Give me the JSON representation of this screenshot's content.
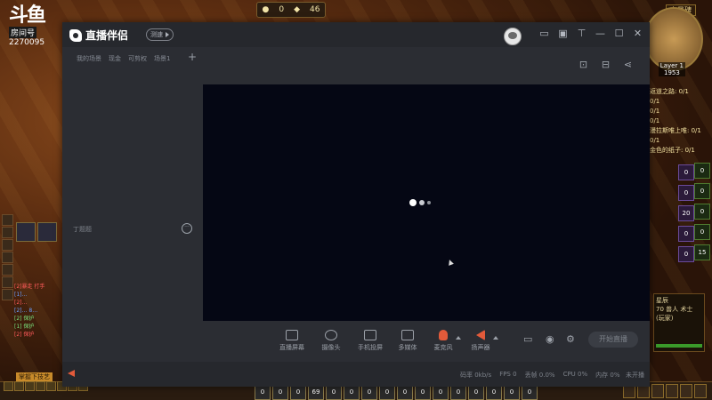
{
  "game": {
    "topbar": {
      "coins": "0",
      "gems": "46"
    },
    "douyu": {
      "logo": "斗鱼",
      "room_label": "房间号",
      "room_id": "2270095"
    },
    "minimap": {
      "tag": "力量碑",
      "layer": "Layer 1",
      "layer_value": "1953"
    },
    "quests": [
      "返道之路: 0/1",
      "0/1",
      "0/1",
      "0/1",
      "漫拉斯唯上唯: 0/1",
      "0/1",
      "金色的纸子: 0/1"
    ],
    "abilities": [
      "0",
      "0",
      "0",
      "0",
      "0",
      "20",
      "0",
      "0",
      "15",
      "0"
    ],
    "target": {
      "name": "星辰",
      "desc": "70 兽人 术士 (玩家)"
    },
    "chat_lines": [
      "[2]暴走 打手",
      "[1]…",
      "[2]…",
      "[2]… 8…",
      "[2] 保护",
      "[1] 保护",
      "[2] 保护"
    ],
    "bottom_tag": "掌握下技艺",
    "bottom_slots": [
      "0",
      "0",
      "0",
      "69",
      "0",
      "0",
      "0",
      "0",
      "0",
      "0",
      "0",
      "0",
      "0",
      "0",
      "0",
      "0"
    ]
  },
  "app": {
    "title": "直播伴侣",
    "badge": "测速",
    "scene_tabs": [
      "我的场景",
      "现金",
      "可剪权",
      "场景1"
    ],
    "scene_add": "+",
    "scene_empty": "丁题题",
    "scene_more": "···",
    "titlebar_icons": [
      "monitor-icon",
      "screen-icon",
      "shirt-icon",
      "minimize-icon",
      "maximize-icon",
      "close-icon"
    ],
    "preview_icons": [
      "gift-icon",
      "layout-icon",
      "share-icon"
    ],
    "controls": [
      {
        "label": "直播屏幕",
        "icon": "screen-capture-icon"
      },
      {
        "label": "摄像头",
        "icon": "camera-icon"
      },
      {
        "label": "手机投屏",
        "icon": "phone-cast-icon"
      },
      {
        "label": "多媒体",
        "icon": "media-icon"
      },
      {
        "label": "麦克风",
        "icon": "microphone-icon"
      },
      {
        "label": "扬声器",
        "icon": "speaker-icon"
      }
    ],
    "go_live": "开始直播",
    "status": {
      "bitrate": "码率 0kb/s",
      "fps": "FPS 0",
      "drop": "丢帧 0.0%",
      "cpu": "CPU 0%",
      "mem": "内存 0%",
      "state": "未开播"
    },
    "colors": {
      "accent": "#e25a3a",
      "preview_bg": "#050714",
      "window_bg": "#2b2d33"
    }
  }
}
